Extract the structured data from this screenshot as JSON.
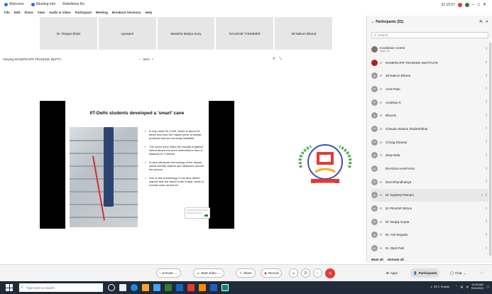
{
  "titlebar": {
    "items": [
      "Welcome",
      "Meeting Info",
      "RideAlone Re"
    ],
    "timer": "01:15:57"
  },
  "menubar": [
    "File",
    "Edit",
    "Share",
    "View",
    "Audio & Video",
    "Participant",
    "Meeting",
    "Breakout Sessions",
    "Help"
  ],
  "thumbnails": [
    "Dr. Ranjan Bhatt",
    "nyaisami",
    "Manisha Madya Suny",
    "RAUSHIE THUMMER",
    "38 Nakum Bharat"
  ],
  "viewbar": {
    "viewing": "Viewing RGNIPM IPR TRAINING INSTIT...",
    "zoom": "64%"
  },
  "slide": {
    "title": "IIT-Delhi students developed a 'smart' cane",
    "bullets": [
      "It only costs Rs 3,000, which is about 25 times less than the market price of similar products that are currently available.",
      "The smart cane helps the visually impaired detect above-the-knee obstructions from a distance of 3 metres.",
      "It uses ultrasonic technology of the radars, which identify objects and obstacles around the person.",
      "Due to this technology, it can also detect objects that are above knee height, which a normal cane cannot do."
    ]
  },
  "panel": {
    "title": "Participants (52)",
    "search_placeholder": "Search",
    "participants": [
      {
        "name": "Incubation Centre",
        "sub": "Host, me",
        "avatar": "",
        "mic": "muted"
      },
      {
        "name": "RGNIPM IPR TRAINING INSTITUTE",
        "sub": "",
        "avatar": "",
        "mic": "on"
      },
      {
        "name": "38 Nakum Bharat",
        "sub": "",
        "avatar": "38",
        "mic": "muted"
      },
      {
        "name": "Amit Patel",
        "sub": "",
        "avatar": "AP",
        "mic": "muted"
      },
      {
        "name": "Anubhav K",
        "sub": "",
        "avatar": "AK",
        "mic": "muted"
      },
      {
        "name": "Bhoomi",
        "sub": "",
        "avatar": "B",
        "mic": "muted"
      },
      {
        "name": "Chavda Hiralum Shaileshbhai",
        "sub": "",
        "avatar": "CH",
        "mic": "muted"
      },
      {
        "name": "Chirag Dhamal",
        "sub": "",
        "avatar": "CD",
        "mic": "muted"
      },
      {
        "name": "deep Bala",
        "sub": "",
        "avatar": "dB",
        "mic": "muted"
      },
      {
        "name": "DHYESH HARIYANI",
        "sub": "",
        "avatar": "DH",
        "mic": "muted"
      },
      {
        "name": "Dixit Dhandhukiya",
        "sub": "",
        "avatar": "DD",
        "mic": "muted"
      },
      {
        "name": "Dr Jaydeep Ramani",
        "sub": "",
        "avatar": "JR",
        "mic": "muted"
      },
      {
        "name": "Dr PRADIP DESAI",
        "sub": "",
        "avatar": "PD",
        "mic": "muted"
      },
      {
        "name": "Dr Sanjay Gupta",
        "sub": "",
        "avatar": "SG",
        "mic": "muted"
      },
      {
        "name": "Dr. Anil Begada",
        "sub": "",
        "avatar": "AB",
        "mic": "muted"
      },
      {
        "name": "Dr. Dipti Patil",
        "sub": "",
        "avatar": "DP",
        "mic": "muted"
      }
    ],
    "mute_all": "Mute all",
    "unmute_all": "Unmute all"
  },
  "controls": {
    "unmute": "Unmute",
    "start_video": "Start video",
    "share": "Share",
    "record": "Record",
    "apps": "Apps",
    "participants": "Participants",
    "chat": "Chat"
  },
  "taskbar": {
    "search_placeholder": "Type here to search",
    "weather": "33°C Smoke",
    "time": "11:50 AM",
    "date": "9/11/2021"
  },
  "colors": {
    "accent": "#1a73e8",
    "leave": "#e53935",
    "muted_icon": "#c62828",
    "taskbar": "#202a38"
  }
}
